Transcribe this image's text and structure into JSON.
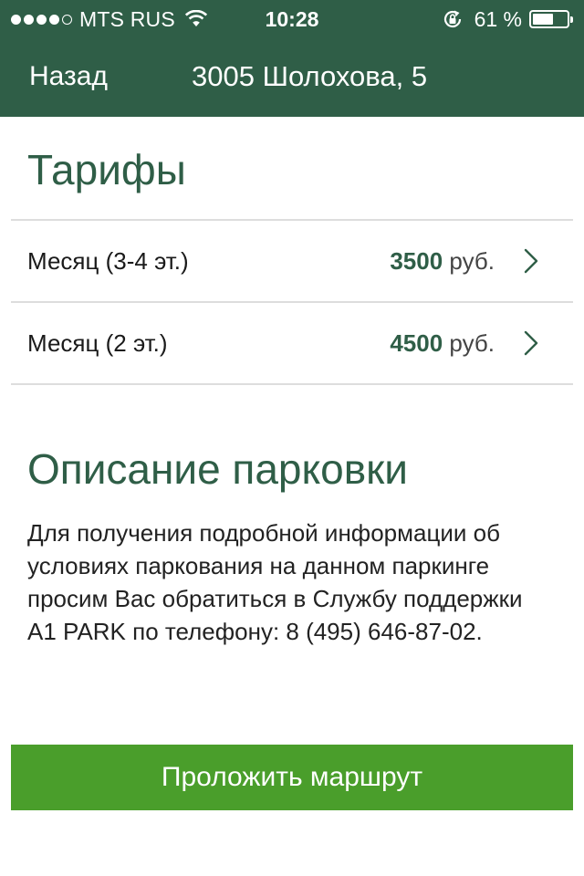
{
  "status_bar": {
    "signal_filled": 4,
    "signal_total": 5,
    "carrier": "MTS RUS",
    "time": "10:28",
    "battery_percent": "61 %",
    "battery_level": 0.61,
    "icons": [
      "signal-dots",
      "wifi-icon",
      "rotation-lock-icon",
      "battery-icon"
    ]
  },
  "nav": {
    "back_label": "Назад",
    "title": "3005 Шолохова, 5"
  },
  "tariffs": {
    "title": "Тарифы",
    "items": [
      {
        "name": "Месяц (3-4 эт.)",
        "price": "3500",
        "unit": "руб."
      },
      {
        "name": "Месяц (2 эт.)",
        "price": "4500",
        "unit": "руб."
      }
    ]
  },
  "description": {
    "title": "Описание парковки",
    "text": "Для получения подробной информации об условиях паркования на данном паркинге просим Вас обратиться в Службу поддержки A1 PARK по телефону: 8 (495) 646-87-02."
  },
  "actions": {
    "route_label": "Проложить маршрут"
  },
  "colors": {
    "header_bg": "#2f5e47",
    "accent_text": "#2f5e47",
    "button_bg": "#4a9e2b"
  }
}
